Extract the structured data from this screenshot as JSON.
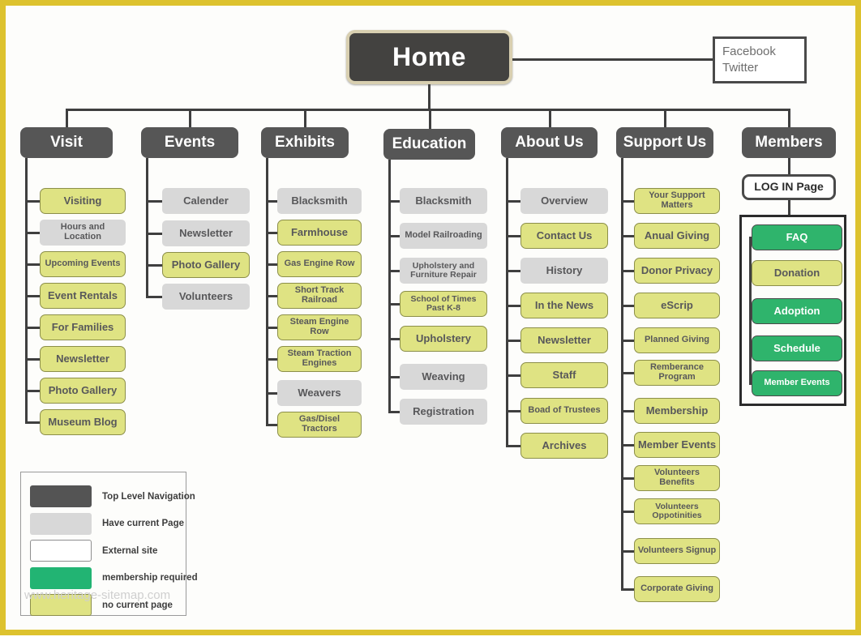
{
  "frame": {
    "border_color": "#ddc22e"
  },
  "palette": {
    "top_level_navigation": "#565656",
    "have_current_page": "#d8d8d8",
    "external_site": "#ffffff",
    "membership_required": "#2fb46c",
    "no_current_page": "#dfe383",
    "home_border": "#d8cfb0",
    "connector": "#3f3f3f"
  },
  "home": {
    "label": "Home"
  },
  "social": {
    "line1": "Facebook",
    "line2": "Twitter"
  },
  "columns": [
    {
      "id": "visit",
      "title": "Visit",
      "items": [
        {
          "label": "Visiting",
          "type": "no_current_page"
        },
        {
          "label": "Hours and Location",
          "type": "have_current_page"
        },
        {
          "label": "Upcoming Events",
          "type": "no_current_page"
        },
        {
          "label": "Event Rentals",
          "type": "no_current_page"
        },
        {
          "label": "For Families",
          "type": "no_current_page"
        },
        {
          "label": "Newsletter",
          "type": "no_current_page"
        },
        {
          "label": "Photo Gallery",
          "type": "no_current_page"
        },
        {
          "label": "Museum Blog",
          "type": "no_current_page"
        }
      ]
    },
    {
      "id": "events",
      "title": "Events",
      "items": [
        {
          "label": "Calender",
          "type": "have_current_page"
        },
        {
          "label": "Newsletter",
          "type": "have_current_page"
        },
        {
          "label": "Photo Gallery",
          "type": "no_current_page"
        },
        {
          "label": "Volunteers",
          "type": "have_current_page"
        }
      ]
    },
    {
      "id": "exhibits",
      "title": "Exhibits",
      "items": [
        {
          "label": "Blacksmith",
          "type": "have_current_page"
        },
        {
          "label": "Farmhouse",
          "type": "no_current_page"
        },
        {
          "label": "Gas Engine Row",
          "type": "no_current_page"
        },
        {
          "label": "Short Track Railroad",
          "type": "no_current_page"
        },
        {
          "label": "Steam Engine Row",
          "type": "no_current_page"
        },
        {
          "label": "Steam Traction Engines",
          "type": "no_current_page"
        },
        {
          "label": "Weavers",
          "type": "have_current_page"
        },
        {
          "label": "Gas/Disel Tractors",
          "type": "no_current_page"
        }
      ]
    },
    {
      "id": "education",
      "title": "Education",
      "items": [
        {
          "label": "Blacksmith",
          "type": "have_current_page"
        },
        {
          "label": "Model Railroading",
          "type": "have_current_page"
        },
        {
          "label": "Upholstery and Furniture Repair",
          "type": "have_current_page"
        },
        {
          "label": "School of Times Past  K-8",
          "type": "no_current_page"
        },
        {
          "label": "Upholstery",
          "type": "no_current_page"
        },
        {
          "label": "Weaving",
          "type": "have_current_page"
        },
        {
          "label": "Registration",
          "type": "have_current_page"
        }
      ]
    },
    {
      "id": "about-us",
      "title": "About Us",
      "items": [
        {
          "label": "Overview",
          "type": "have_current_page"
        },
        {
          "label": "Contact Us",
          "type": "no_current_page"
        },
        {
          "label": "History",
          "type": "have_current_page"
        },
        {
          "label": "In the News",
          "type": "no_current_page"
        },
        {
          "label": "Newsletter",
          "type": "no_current_page"
        },
        {
          "label": "Staff",
          "type": "no_current_page"
        },
        {
          "label": "Boad of Trustees",
          "type": "no_current_page"
        },
        {
          "label": "Archives",
          "type": "no_current_page"
        }
      ]
    },
    {
      "id": "support-us",
      "title": "Support Us",
      "items": [
        {
          "label": "Your Support Matters",
          "type": "no_current_page"
        },
        {
          "label": "Anual Giving",
          "type": "no_current_page"
        },
        {
          "label": "Donor Privacy",
          "type": "no_current_page"
        },
        {
          "label": "eScrip",
          "type": "no_current_page"
        },
        {
          "label": "Planned Giving",
          "type": "no_current_page"
        },
        {
          "label": "Remberance Program",
          "type": "no_current_page"
        },
        {
          "label": "Membership",
          "type": "no_current_page"
        },
        {
          "label": "Member Events",
          "type": "no_current_page"
        },
        {
          "label": "Volunteers Benefits",
          "type": "no_current_page"
        },
        {
          "label": "Volunteers Oppotinities",
          "type": "no_current_page"
        },
        {
          "label": "Volunteers Signup",
          "type": "no_current_page"
        },
        {
          "label": "Corporate Giving",
          "type": "no_current_page"
        }
      ]
    },
    {
      "id": "members",
      "title": "Members",
      "login": {
        "label": "LOG IN Page",
        "type": "external_site"
      },
      "items": [
        {
          "label": "FAQ",
          "type": "membership_required"
        },
        {
          "label": "Donation",
          "type": "no_current_page"
        },
        {
          "label": "Adoption",
          "type": "membership_required"
        },
        {
          "label": "Schedule",
          "type": "membership_required"
        },
        {
          "label": "Member Events",
          "type": "membership_required"
        }
      ]
    }
  ],
  "legend": {
    "rows": [
      {
        "swatch": "dark",
        "label": "Top Level Navigation"
      },
      {
        "swatch": "light",
        "label": "Have current Page"
      },
      {
        "swatch": "white",
        "label": "External site"
      },
      {
        "swatch": "grn",
        "label": "membership required"
      },
      {
        "swatch": "yel",
        "label": "no current page"
      }
    ]
  },
  "watermark": {
    "text": "www.heritage-sitemap.com"
  }
}
